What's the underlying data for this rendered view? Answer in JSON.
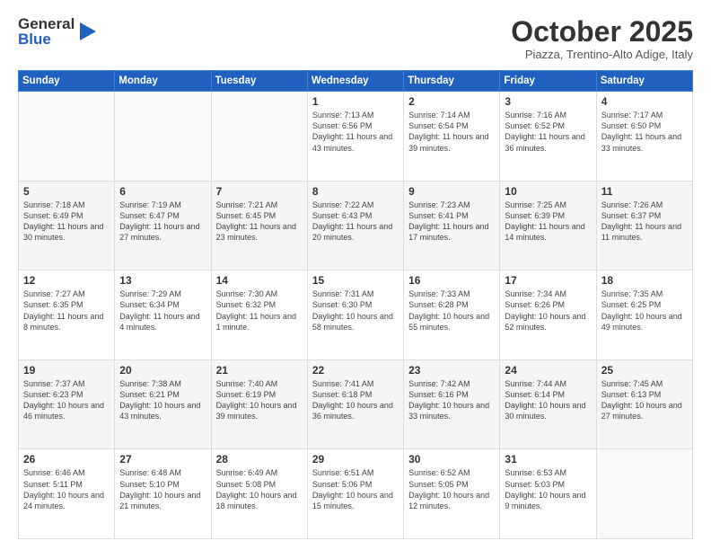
{
  "logo": {
    "general": "General",
    "blue": "Blue"
  },
  "header": {
    "month": "October 2025",
    "location": "Piazza, Trentino-Alto Adige, Italy"
  },
  "weekdays": [
    "Sunday",
    "Monday",
    "Tuesday",
    "Wednesday",
    "Thursday",
    "Friday",
    "Saturday"
  ],
  "weeks": [
    [
      {
        "day": "",
        "info": ""
      },
      {
        "day": "",
        "info": ""
      },
      {
        "day": "",
        "info": ""
      },
      {
        "day": "1",
        "info": "Sunrise: 7:13 AM\nSunset: 6:56 PM\nDaylight: 11 hours and 43 minutes."
      },
      {
        "day": "2",
        "info": "Sunrise: 7:14 AM\nSunset: 6:54 PM\nDaylight: 11 hours and 39 minutes."
      },
      {
        "day": "3",
        "info": "Sunrise: 7:16 AM\nSunset: 6:52 PM\nDaylight: 11 hours and 36 minutes."
      },
      {
        "day": "4",
        "info": "Sunrise: 7:17 AM\nSunset: 6:50 PM\nDaylight: 11 hours and 33 minutes."
      }
    ],
    [
      {
        "day": "5",
        "info": "Sunrise: 7:18 AM\nSunset: 6:49 PM\nDaylight: 11 hours and 30 minutes."
      },
      {
        "day": "6",
        "info": "Sunrise: 7:19 AM\nSunset: 6:47 PM\nDaylight: 11 hours and 27 minutes."
      },
      {
        "day": "7",
        "info": "Sunrise: 7:21 AM\nSunset: 6:45 PM\nDaylight: 11 hours and 23 minutes."
      },
      {
        "day": "8",
        "info": "Sunrise: 7:22 AM\nSunset: 6:43 PM\nDaylight: 11 hours and 20 minutes."
      },
      {
        "day": "9",
        "info": "Sunrise: 7:23 AM\nSunset: 6:41 PM\nDaylight: 11 hours and 17 minutes."
      },
      {
        "day": "10",
        "info": "Sunrise: 7:25 AM\nSunset: 6:39 PM\nDaylight: 11 hours and 14 minutes."
      },
      {
        "day": "11",
        "info": "Sunrise: 7:26 AM\nSunset: 6:37 PM\nDaylight: 11 hours and 11 minutes."
      }
    ],
    [
      {
        "day": "12",
        "info": "Sunrise: 7:27 AM\nSunset: 6:35 PM\nDaylight: 11 hours and 8 minutes."
      },
      {
        "day": "13",
        "info": "Sunrise: 7:29 AM\nSunset: 6:34 PM\nDaylight: 11 hours and 4 minutes."
      },
      {
        "day": "14",
        "info": "Sunrise: 7:30 AM\nSunset: 6:32 PM\nDaylight: 11 hours and 1 minute."
      },
      {
        "day": "15",
        "info": "Sunrise: 7:31 AM\nSunset: 6:30 PM\nDaylight: 10 hours and 58 minutes."
      },
      {
        "day": "16",
        "info": "Sunrise: 7:33 AM\nSunset: 6:28 PM\nDaylight: 10 hours and 55 minutes."
      },
      {
        "day": "17",
        "info": "Sunrise: 7:34 AM\nSunset: 6:26 PM\nDaylight: 10 hours and 52 minutes."
      },
      {
        "day": "18",
        "info": "Sunrise: 7:35 AM\nSunset: 6:25 PM\nDaylight: 10 hours and 49 minutes."
      }
    ],
    [
      {
        "day": "19",
        "info": "Sunrise: 7:37 AM\nSunset: 6:23 PM\nDaylight: 10 hours and 46 minutes."
      },
      {
        "day": "20",
        "info": "Sunrise: 7:38 AM\nSunset: 6:21 PM\nDaylight: 10 hours and 43 minutes."
      },
      {
        "day": "21",
        "info": "Sunrise: 7:40 AM\nSunset: 6:19 PM\nDaylight: 10 hours and 39 minutes."
      },
      {
        "day": "22",
        "info": "Sunrise: 7:41 AM\nSunset: 6:18 PM\nDaylight: 10 hours and 36 minutes."
      },
      {
        "day": "23",
        "info": "Sunrise: 7:42 AM\nSunset: 6:16 PM\nDaylight: 10 hours and 33 minutes."
      },
      {
        "day": "24",
        "info": "Sunrise: 7:44 AM\nSunset: 6:14 PM\nDaylight: 10 hours and 30 minutes."
      },
      {
        "day": "25",
        "info": "Sunrise: 7:45 AM\nSunset: 6:13 PM\nDaylight: 10 hours and 27 minutes."
      }
    ],
    [
      {
        "day": "26",
        "info": "Sunrise: 6:46 AM\nSunset: 5:11 PM\nDaylight: 10 hours and 24 minutes."
      },
      {
        "day": "27",
        "info": "Sunrise: 6:48 AM\nSunset: 5:10 PM\nDaylight: 10 hours and 21 minutes."
      },
      {
        "day": "28",
        "info": "Sunrise: 6:49 AM\nSunset: 5:08 PM\nDaylight: 10 hours and 18 minutes."
      },
      {
        "day": "29",
        "info": "Sunrise: 6:51 AM\nSunset: 5:06 PM\nDaylight: 10 hours and 15 minutes."
      },
      {
        "day": "30",
        "info": "Sunrise: 6:52 AM\nSunset: 5:05 PM\nDaylight: 10 hours and 12 minutes."
      },
      {
        "day": "31",
        "info": "Sunrise: 6:53 AM\nSunset: 5:03 PM\nDaylight: 10 hours and 9 minutes."
      },
      {
        "day": "",
        "info": ""
      }
    ]
  ]
}
